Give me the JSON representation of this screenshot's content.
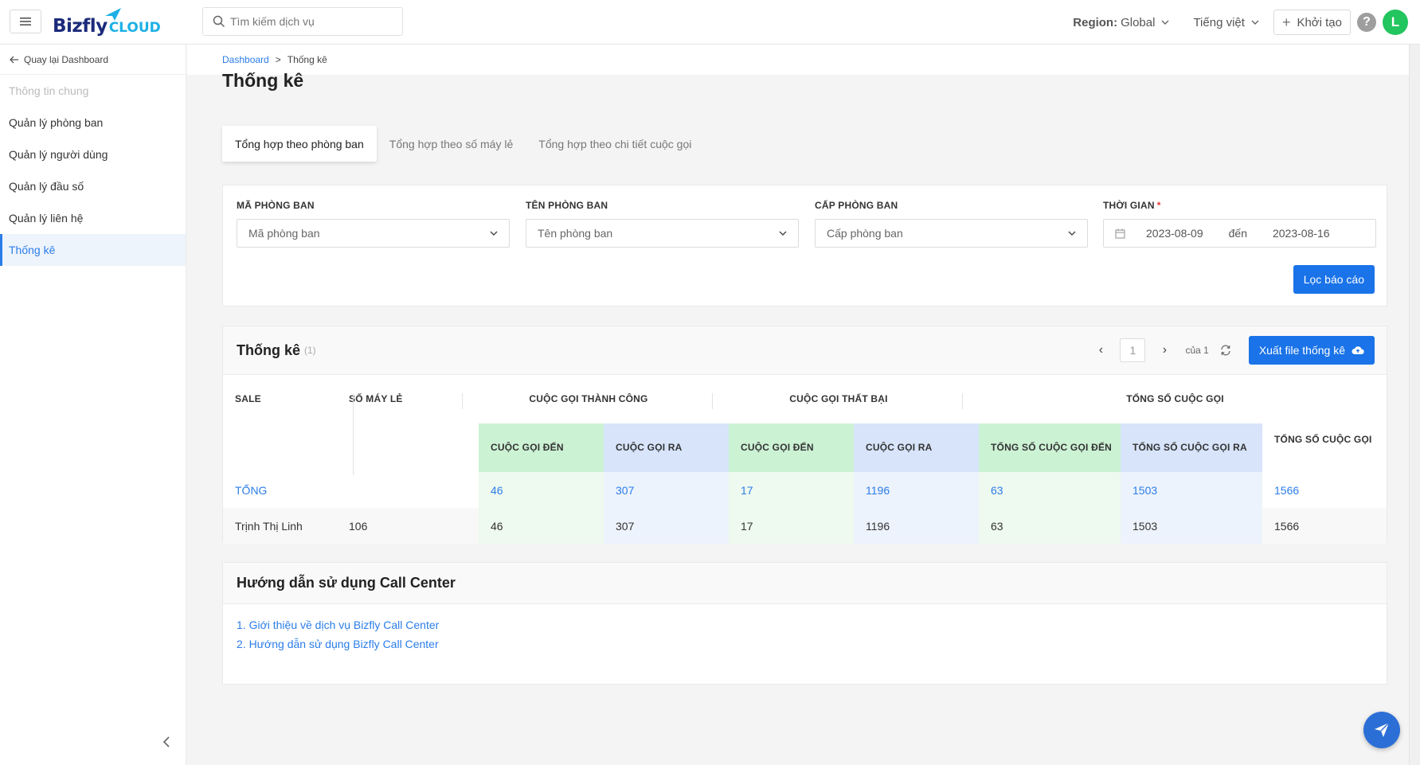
{
  "header": {
    "logo_main": "Bizfly",
    "logo_sub": "CLOUD",
    "search_placeholder": "Tìm kiếm dịch vụ",
    "region_label": "Region:",
    "region_value": "Global",
    "language": "Tiếng việt",
    "create_label": "Khởi tạo",
    "help": "?",
    "avatar_initial": "L"
  },
  "sidebar": {
    "back_label": "Quay lại Dashboard",
    "items": [
      {
        "label": "Thông tin chung",
        "state": "disabled"
      },
      {
        "label": "Quản lý phòng ban",
        "state": "normal"
      },
      {
        "label": "Quản lý người dùng",
        "state": "normal"
      },
      {
        "label": "Quản lý đầu số",
        "state": "normal"
      },
      {
        "label": "Quản lý liên hệ",
        "state": "normal"
      },
      {
        "label": "Thống kê",
        "state": "active"
      }
    ]
  },
  "breadcrumb": {
    "root": "Dashboard",
    "separator": ">",
    "current": "Thống kê"
  },
  "page": {
    "title": "Thống kê",
    "tabs": [
      {
        "label": "Tổng hợp theo phòng ban",
        "active": true
      },
      {
        "label": "Tổng hợp theo số máy lẻ",
        "active": false
      },
      {
        "label": "Tổng hợp theo chi tiết cuộc gọi",
        "active": false
      }
    ]
  },
  "filters": {
    "dept_code": {
      "label": "MÃ PHÒNG BAN",
      "placeholder": "Mã phòng ban"
    },
    "dept_name": {
      "label": "TÊN PHÒNG BAN",
      "placeholder": "Tên phòng ban"
    },
    "dept_level": {
      "label": "CẤP PHÒNG BAN",
      "placeholder": "Cấp phòng ban"
    },
    "time": {
      "label": "THỜI GIAN",
      "required_mark": "*",
      "from": "2023-08-09",
      "to_label": "đến",
      "to": "2023-08-16"
    },
    "submit_label": "Lọc báo cáo"
  },
  "stats": {
    "title": "Thống kê",
    "count": "(1)",
    "pager": {
      "prev": "‹",
      "page": "1",
      "next": "›",
      "of_label": "của 1"
    },
    "export_label": "Xuất file thống kê",
    "headers": {
      "sale": "SALE",
      "ext": "SỐ MÁY LẺ",
      "success": "CUỘC GỌI THÀNH CÔNG",
      "failed": "CUỘC GỌI THẤT BẠI",
      "total": "TỔNG SỐ CUỘC GỌI",
      "sub": [
        "CUỘC GỌI ĐẾN",
        "CUỘC GỌI RA",
        "CUỘC GỌI ĐẾN",
        "CUỘC GỌI RA",
        "TỔNG SỐ CUỘC GỌI ĐẾN",
        "TỔNG SỐ CUỘC GỌI RA",
        "TỔNG SỐ CUỘC GỌI"
      ]
    },
    "total_row": {
      "label": "TỔNG",
      "ext": "",
      "values": [
        "46",
        "307",
        "17",
        "1196",
        "63",
        "1503",
        "1566"
      ]
    },
    "rows": [
      {
        "sale": "Trịnh Thị Linh",
        "ext": "106",
        "values": [
          "46",
          "307",
          "17",
          "1196",
          "63",
          "1503",
          "1566"
        ]
      }
    ]
  },
  "guide": {
    "title": "Hướng dẫn sử dụng Call Center",
    "links": [
      "1. Giới thiệu về dịch vụ Bizfly Call Center",
      "2. Hướng dẫn sử dụng Bizfly Call Center"
    ]
  },
  "colors": {
    "primary": "#1a73e8",
    "success_header": "#ccf2d4",
    "outgoing_header": "#d7e4fa",
    "avatar": "#22c55e"
  }
}
